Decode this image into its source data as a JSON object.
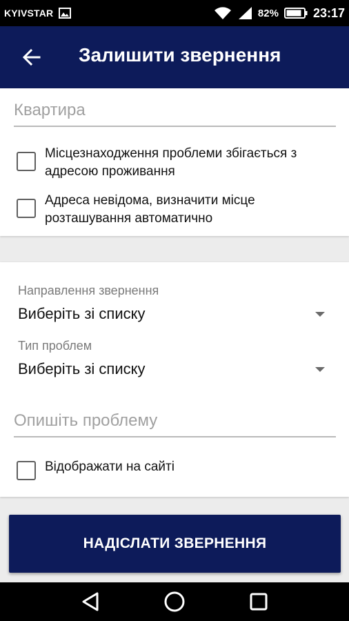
{
  "status_bar": {
    "carrier": "KYIVSTAR",
    "battery_percent": "82%",
    "time": "23:17"
  },
  "app_bar": {
    "title": "Залишити звернення",
    "back_icon": "arrow-back-icon"
  },
  "address_card": {
    "apartment_placeholder": "Квартира",
    "checkbox_same_address": {
      "label": "Місцезнаходження проблеми збігається з адресою проживання",
      "checked": false
    },
    "checkbox_unknown_address": {
      "label": "Адреса невідома, визначити місце розташування автоматично",
      "checked": false
    }
  },
  "problem_card": {
    "direction": {
      "label": "Направлення звернення",
      "value": "Виберіть зі списку"
    },
    "problem_type": {
      "label": "Тип проблем",
      "value": "Виберіть зі списку"
    },
    "description_placeholder": "Опишіть проблему",
    "checkbox_show_on_site": {
      "label": "Відображати на сайті",
      "checked": false
    }
  },
  "submit_label": "НАДІСЛАТИ ЗВЕРНЕННЯ",
  "colors": {
    "primary": "#0d1b5a",
    "background": "#ececec",
    "hint": "#a0a0a0"
  }
}
